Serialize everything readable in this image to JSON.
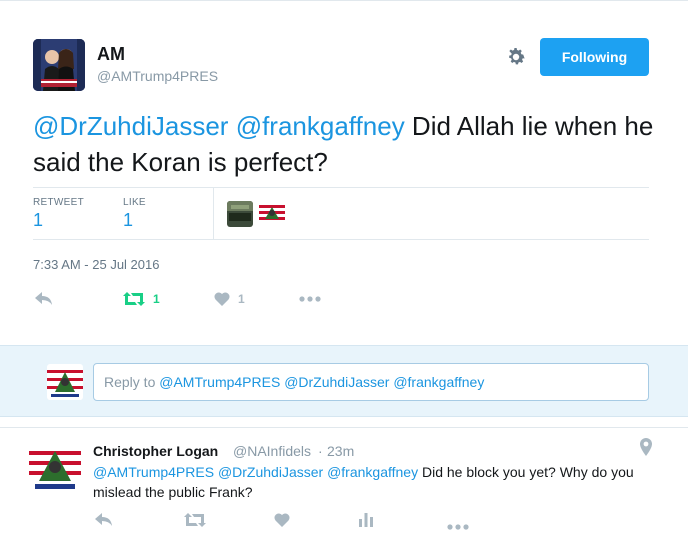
{
  "header": {
    "name": "AM",
    "handle": "@AMTrump4PRES",
    "follow_label": "Following"
  },
  "tweet": {
    "mention1": "@DrZuhdiJasser",
    "mention2": "@frankgaffney",
    "text": " Did Allah lie when he said the Koran is perfect?"
  },
  "stats": {
    "retweet_label": "RETWEET",
    "retweet_count": "1",
    "like_label": "LIKE",
    "like_count": "1"
  },
  "timestamp": "7:33 AM - 25 Jul 2016",
  "actions": {
    "retweet_count": "1",
    "like_count": "1"
  },
  "reply_box": {
    "prefix": "Reply to ",
    "mentions": "@AMTrump4PRES @DrZuhdiJasser @frankgaffney"
  },
  "reply": {
    "name": "Christopher Logan",
    "handle": "@NAInfidels",
    "dot": "·",
    "time": "23m",
    "mentions": "@AMTrump4PRES @DrZuhdiJasser @frankgaffney",
    "text": " Did he block you yet? Why do you mislead the public Frank?"
  },
  "colors": {
    "accent": "#1da1f2",
    "link": "#1b95e0",
    "retweet_green": "#19cf86",
    "icon_gray": "#aab8c2"
  },
  "icons": [
    "gear-icon",
    "reply-icon",
    "retweet-icon",
    "heart-icon",
    "more-icon",
    "pin-icon",
    "analytics-icon"
  ]
}
